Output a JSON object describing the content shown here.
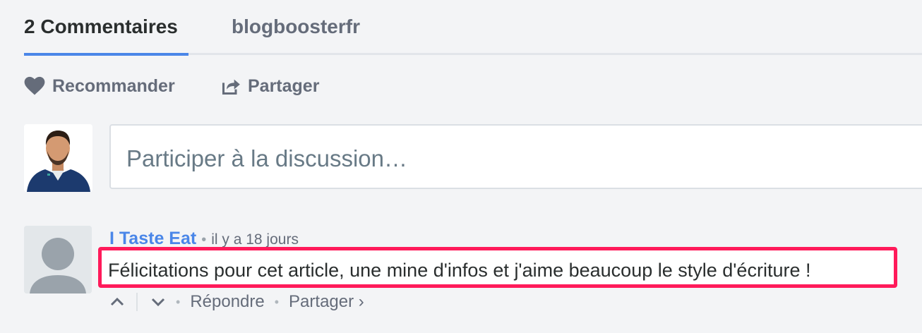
{
  "tabs": {
    "comments": "2 Commentaires",
    "site": "blogboosterfr"
  },
  "actions": {
    "recommend": "Recommander",
    "share": "Partager"
  },
  "composer": {
    "placeholder": "Participer à la discussion…"
  },
  "comment": {
    "author": "I Taste Eat",
    "separator": "•",
    "timestamp": "il y a 18 jours",
    "text": "Félicitations pour cet article, une mine d'infos et j'aime beaucoup le style d'écriture !",
    "reply": "Répondre",
    "share": "Partager ›"
  },
  "icons": {
    "recommend": "heart-icon",
    "share": "share-icon",
    "upvote": "chevron-up-icon",
    "downvote": "chevron-down-icon"
  },
  "colors": {
    "accent": "#4a86e8",
    "highlight": "#ff1a5a",
    "muted": "#656c7a"
  }
}
